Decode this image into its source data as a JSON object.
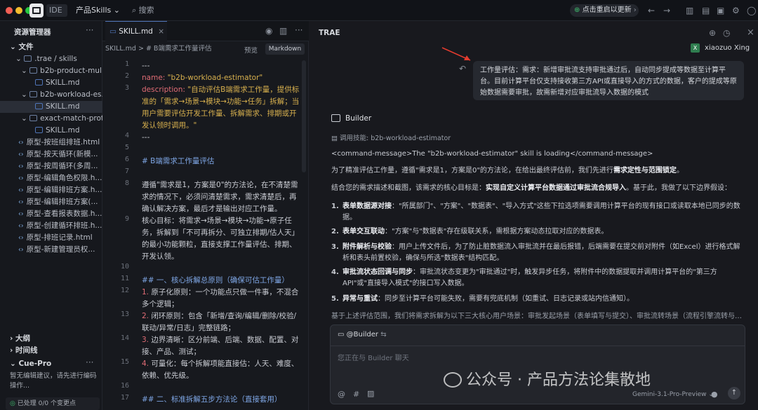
{
  "titlebar": {
    "ide_tab": "IDE",
    "product_tab": "产品Skills",
    "search": "搜索",
    "update": "点击重启以更新"
  },
  "explorer": {
    "title": "资源管理器",
    "files_label": "文件",
    "items": [
      ".trae / skills",
      "b2b-product-mul...",
      "SKILL.md",
      "b2b-workload-es...",
      "SKILL.md",
      "exact-match-prot...",
      "SKILL.md",
      "原型-按班组排班.html",
      "原型-按天循环(新模...",
      "原型-按周循环(多周...",
      "原型-编辑角色权限.h...",
      "原型-编辑排班方案.h...",
      "原型-编辑排班方案(...",
      "原型-查看报表数据.h...",
      "原型-创建循环排班.h...",
      "原型-排班记录.html",
      "原型-新建管理员权..."
    ],
    "outline": "大纲",
    "timeline": "时间线",
    "cue_title": "Cue-Pro",
    "cue_text": "暂无编辑建议，请先进行编码操作...",
    "status": "已处理 0/0 个变更点"
  },
  "editor": {
    "tab": "SKILL.md",
    "breadcrumb": "SKILL.md  >  # B端需求工作量评估",
    "preview": "预览",
    "markdown": "Markdown",
    "numbers": [
      "1",
      "2",
      "3",
      "4",
      "5",
      "6",
      "7",
      "8",
      "9",
      "10",
      "11",
      "12",
      "13",
      "14",
      "15",
      "16",
      "17"
    ],
    "l1": "---",
    "l2_key": "name:",
    "l2_val": "\"b2b-workload-estimator\"",
    "l3_key": "description:",
    "l3_val": "\"自动评估B端需求工作量，提供标准的「需求→场景→模块→功能→任务」拆解；当用户需要评估开发工作量、拆解需求、排期或开发认领时调用。\"",
    "l4": "---",
    "l6": "# B端需求工作量评估",
    "l8": "遵循\"需求是1，方案是0\"的方法论，在不清楚需求的情况下，必须问清楚需求，需求清楚后，再确认解决方案，最后才是输出对应工作量。",
    "l9": "核心目标：将需求→场景→模块→功能→原子任务，拆解到「不可再拆分、可独立排期/估人天」的最小功能颗粒，直接支撑工作量评估、排期、开发认领。",
    "l11": "## 一、核心拆解总原则（确保可估工作量）",
    "l12_n": "1.",
    "l12": "原子化原则：一个功能点只做一件事，不混合多个逻辑；",
    "l13_n": "2.",
    "l13": "闭环原则：包含「新增/查询/编辑/删除/校验/联动/异常/日志」完整链路；",
    "l14_n": "3.",
    "l14": "边界清晰：区分前端、后端、数据、配置、对接、产品、测试；",
    "l15_n": "4.",
    "l15": "可量化：每个拆解项能直接估：人天、难度、依赖、优先级。",
    "l17": "## 二、标准拆解五步方法论（直接套用）"
  },
  "chat": {
    "title": "TRAE",
    "user_avatar": "X",
    "user_name": "xiaozuo Xing",
    "user_msg": "工作量评估：需求：新增审批流支持审批通过后，自动同步提成等数据至计算平台。目前计算平台仅支持接收第三方API或直接导入的方式的数据，客户的提成等原始数据需要审批，故需新增对应审批流导入数据的模式",
    "bot_name": "Builder",
    "skill_call": "调用技能: b2b-workload-estimator",
    "command": "<command-message>The \"b2b-workload-estimator\" skill is loading</command-message>",
    "p1_a": "为了精准评估工作量，遵循\"需求是1，方案是0\"的方法论，在给出最终评估前，我们先进行",
    "p1_b": "需求定性与范围锁定",
    "p1_c": "。",
    "p2_a": "结合您的需求描述和截图，该需求的核心目标是：",
    "p2_b": "实现自定义计算平台数据通过审批流合规导入",
    "p2_c": "。基于此，我做了以下边界假设：",
    "list": [
      {
        "n": "1.",
        "h": "表单数据源对接",
        "t": "：\"所属部门\"、\"方案\"、\"数据表\"、\"导入方式\"这些下拉选项需要调用计算平台的现有接口或读取本地已同步的数据。"
      },
      {
        "n": "2.",
        "h": "表单交互联动",
        "t": "：\"方案\"与\"数据表\"存在级联关系，需根据方案动态拉取对应的数据表。"
      },
      {
        "n": "3.",
        "h": "附件解析与校验",
        "t": "：用户上传文件后，为了防止脏数据流入审批流并在最后报错，后端需要在提交前对附件（如Excel）进行格式解析和表头前置校验，确保与所选\"数据表\"结构匹配。"
      },
      {
        "n": "4.",
        "h": "审批流状态回调与同步",
        "t": "：审批流状态变更为\"审批通过\"时，触发异步任务，将附件中的数据提取并调用计算平台的\"第三方API\"或\"直接导入模式\"的接口写入数据。"
      },
      {
        "n": "5.",
        "h": "异常与重试",
        "t": "：同步至计算平台可能失败，需要有兜底机制（如重试、日志记录或站内信通知）。"
      }
    ],
    "p3": "基于上述评估范围，我们将需求拆解为以下三大核心用户场景：审批发起场景（表单填写与提交）、审批流转场景（流程引擎流转与…",
    "builder_tag": "@Builder",
    "input_placeholder": "您正在与 Builder 聊天",
    "model": "Gemini-3.1-Pro-Preview"
  },
  "watermark": "公众号 · 产品方法论集散地"
}
